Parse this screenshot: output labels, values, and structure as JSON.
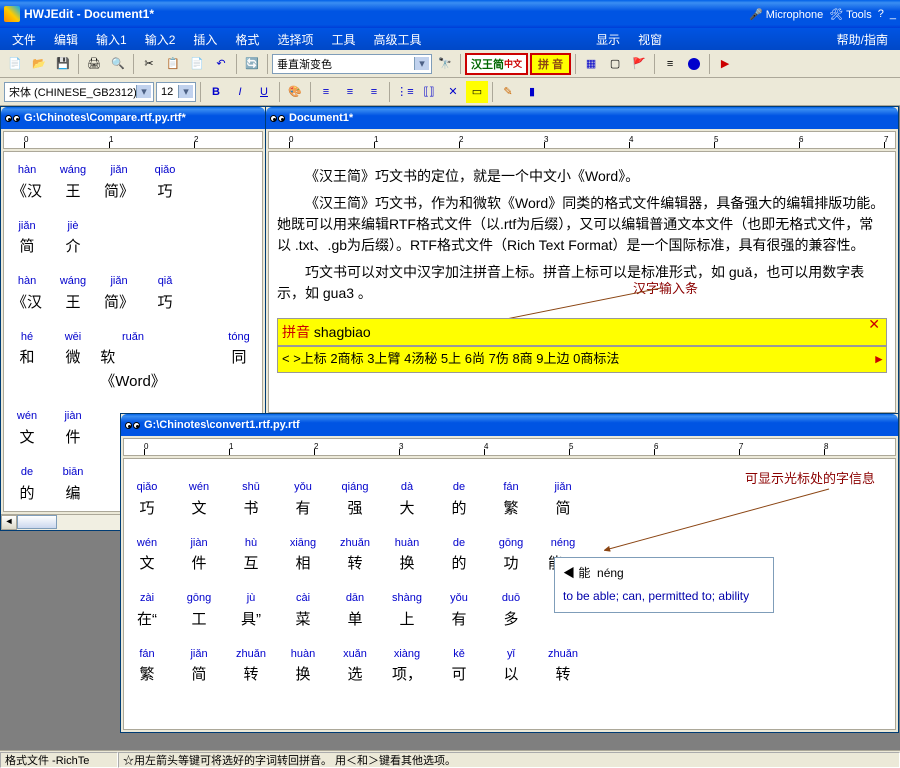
{
  "app": {
    "title": "HWJEdit - Document1*",
    "titlebar_tools": [
      "Microphone",
      "Tools"
    ]
  },
  "menu": [
    "文件",
    "编辑",
    "输入1",
    "输入2",
    "插入",
    "格式",
    "选择项",
    "工具",
    "高级工具",
    "显示",
    "视窗",
    "帮助/指南"
  ],
  "toolbar1": {
    "combo_gradient": "垂直渐变色",
    "hanwang_label": "汉王简",
    "hanwang_suffix": "中文",
    "pinyin_label": "拼 音"
  },
  "toolbar2": {
    "font_name": "宋体 (CHINESE_GB2312)",
    "font_size": "12"
  },
  "windows": {
    "left": {
      "title": "G:\\Chinotes\\Compare.rtf.py.rtf*",
      "rows": [
        {
          "py": [
            "hàn",
            "wáng",
            "jiǎn",
            "qiǎo",
            ""
          ],
          "ch": [
            "《汉",
            "王",
            "简》",
            "巧",
            ""
          ]
        },
        {
          "py": [
            "jiǎn",
            "jiè"
          ],
          "ch": [
            "简",
            "介"
          ]
        },
        {
          "py": [
            "hàn",
            "wáng",
            "jiǎn",
            "qiǎ"
          ],
          "ch": [
            "《汉",
            "王",
            "简》",
            "巧"
          ]
        },
        {
          "py": [
            "hé",
            "wēi",
            "ruǎn",
            "",
            "tóng"
          ],
          "ch": [
            "和",
            "微",
            "软《Word》",
            "",
            "同"
          ]
        },
        {
          "py": [
            "wén",
            "jiàn"
          ],
          "ch": [
            "文",
            "件"
          ]
        },
        {
          "py": [
            "de",
            "biān"
          ],
          "ch": [
            "的",
            "编"
          ]
        }
      ]
    },
    "main": {
      "title": "Document1*",
      "paras": [
        "《汉王简》巧文书的定位，就是一个中文小《Word》。",
        "《汉王简》巧文书，作为和微软《Word》同类的格式文件编辑器，具备强大的编辑排版功能。她既可以用来编辑RTF格式文件（以.rtf为后缀），又可以编辑普通文本文件（也即无格式文件，常以 .txt、.gb为后缀）。RTF格式文件（Rich Text Format）是一个国际标准，具有很强的兼容性。",
        "巧文书可以对文中汉字加注拼音上标。拼音上标可以是标准形式，如 guǎ，也可以用数字表示，如 gua3 。"
      ],
      "input_label": "拼音",
      "input_text": "shagbiao",
      "candidates": "< >上标  2商标  3上臂  4汤秘  5上  6尚  7伤  8商  9上边  0商标法",
      "annotation1": "汉字输入条"
    },
    "bottom": {
      "title": "G:\\Chinotes\\convert1.rtf.py.rtf",
      "rows": [
        {
          "py": [
            "qiǎo",
            "wén",
            "shū",
            "yǒu",
            "qiáng",
            "dà",
            "de",
            "fán",
            "jiǎn"
          ],
          "ch": [
            "巧",
            "文",
            "书",
            "有",
            "强",
            "大",
            "的",
            "繁",
            "简"
          ]
        },
        {
          "py": [
            "wén",
            "jiàn",
            "hù",
            "xiāng",
            "zhuǎn",
            "huàn",
            "de",
            "gōng",
            "néng"
          ],
          "ch": [
            "文",
            "件",
            "互",
            "相",
            "转",
            "换",
            "的",
            "功",
            "能。"
          ]
        },
        {
          "py": [
            "zài",
            "gōng",
            "jù",
            "cài",
            "dān",
            "shàng",
            "yǒu",
            "duō"
          ],
          "ch": [
            "在“",
            "工",
            "具”",
            "菜",
            "单",
            "上",
            "有",
            "多"
          ]
        },
        {
          "py": [
            "fán",
            "jiǎn",
            "zhuǎn",
            "huàn",
            "xuǎn",
            "xiàng",
            "kě",
            "yǐ",
            "zhuǎn"
          ],
          "ch": [
            "繁",
            "简",
            "转",
            "换",
            "选",
            "项，",
            "可",
            "以",
            "转"
          ]
        }
      ],
      "annotation2": "可显示光标处的字信息",
      "tooltip": {
        "char": "能",
        "pinyin": "néng",
        "def": "to be able; can, permitted to; ability"
      }
    }
  },
  "status": {
    "left": "格式文件 -RichTe",
    "right": "☆用左箭头等键可将选好的字词转回拼音。 用＜和＞键看其他选项。"
  }
}
